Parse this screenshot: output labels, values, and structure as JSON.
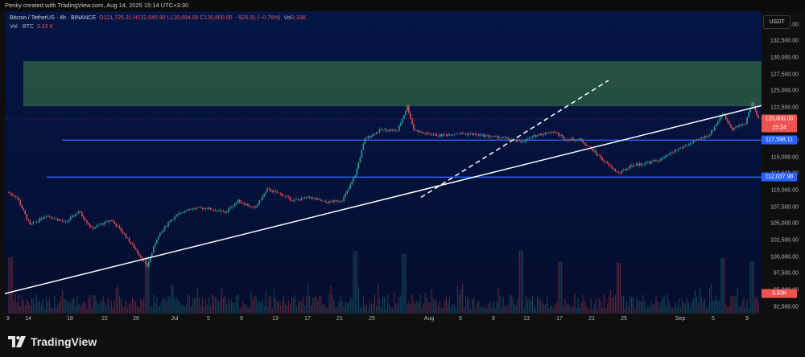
{
  "header": {
    "credit": "Penky created with TradingView.com, Aug 14, 2025 15:14 UTC+3:30"
  },
  "legend": {
    "symbol": "Bitcoin / TetherUS · 4h · BINANCE",
    "ohlc": "O121,725.31 H122,045.90 L120,694.00 C120,800.00",
    "change": "−925.31 (−0.76%)",
    "vol_prefix": "Vol",
    "vol_value": "3.33K",
    "vol_row_label": "Vol · BTC",
    "vol_row_value": "3.33 K"
  },
  "currency_button": "USDT",
  "price_axis": {
    "ticks": [
      "135,000.00",
      "132,500.00",
      "130,000.00",
      "127,500.00",
      "125,000.00",
      "122,500.00",
      "117,500.00",
      "115,000.00",
      "112,500.00",
      "110,000.00",
      "107,500.00",
      "105,000.00",
      "102,500.00",
      "100,000.00",
      "97,500.00",
      "95,000.00",
      "92,500.00"
    ],
    "last_price": "120,800.00",
    "countdown": "15:24",
    "level1": "117,598.11",
    "level2": "112,037.98",
    "volume_tag": "3.33K"
  },
  "time_axis": [
    "9",
    "14",
    "18",
    "22",
    "26",
    "Jul",
    "5",
    "9",
    "13",
    "17",
    "21",
    "25",
    "Aug",
    "5",
    "9",
    "13",
    "17",
    "21",
    "25",
    "Sep",
    "5",
    "9"
  ],
  "brand": "TradingView",
  "colors": {
    "up": "#26a69a",
    "down": "#ef5350",
    "level": "#2962ff",
    "zone": "#2d5a45"
  },
  "chart_data": {
    "type": "candlestick",
    "ylim": [
      91500,
      137000
    ],
    "levels": [
      117598.11,
      112037.98
    ],
    "last": 120800,
    "zone": [
      122700,
      129500
    ],
    "anchors": [
      [
        0,
        109800
      ],
      [
        6,
        109000
      ],
      [
        14,
        104800
      ],
      [
        24,
        106300
      ],
      [
        36,
        105200
      ],
      [
        44,
        106900
      ],
      [
        52,
        104300
      ],
      [
        64,
        105600
      ],
      [
        72,
        103400
      ],
      [
        80,
        100800
      ],
      [
        86,
        98600
      ],
      [
        92,
        102800
      ],
      [
        100,
        105500
      ],
      [
        110,
        107200
      ],
      [
        122,
        107400
      ],
      [
        134,
        106700
      ],
      [
        142,
        108500
      ],
      [
        152,
        107300
      ],
      [
        160,
        110200
      ],
      [
        168,
        109500
      ],
      [
        176,
        108500
      ],
      [
        186,
        109000
      ],
      [
        196,
        108200
      ],
      [
        206,
        108600
      ],
      [
        210,
        110300
      ],
      [
        214,
        112400
      ],
      [
        220,
        117800
      ],
      [
        230,
        119200
      ],
      [
        240,
        119000
      ],
      [
        246,
        122700
      ],
      [
        250,
        119200
      ],
      [
        256,
        118600
      ],
      [
        266,
        118300
      ],
      [
        276,
        118600
      ],
      [
        286,
        118500
      ],
      [
        296,
        118200
      ],
      [
        306,
        117900
      ],
      [
        316,
        117300
      ],
      [
        326,
        118400
      ],
      [
        336,
        118900
      ],
      [
        344,
        117700
      ],
      [
        352,
        117700
      ],
      [
        360,
        116100
      ],
      [
        368,
        114200
      ],
      [
        376,
        112600
      ],
      [
        384,
        113800
      ],
      [
        392,
        114100
      ],
      [
        402,
        114700
      ],
      [
        412,
        116200
      ],
      [
        422,
        117300
      ],
      [
        432,
        118500
      ],
      [
        440,
        121600
      ],
      [
        446,
        119300
      ],
      [
        454,
        120200
      ],
      [
        458,
        123300
      ],
      [
        462,
        120800
      ]
    ],
    "volume_spikes": [
      [
        2,
        0.75
      ],
      [
        86,
        0.78
      ],
      [
        214,
        0.95
      ],
      [
        244,
        0.85
      ],
      [
        316,
        0.96
      ],
      [
        340,
        0.6
      ],
      [
        376,
        0.58
      ],
      [
        440,
        0.72
      ],
      [
        458,
        0.62
      ]
    ],
    "trendlines": [
      {
        "x": [
          0,
          940
        ],
        "y": [
          94500,
          122800
        ],
        "style": "solid"
      },
      {
        "x": [
          517,
          750
        ],
        "y": [
          109000,
          126600
        ],
        "style": "dashed"
      }
    ]
  }
}
